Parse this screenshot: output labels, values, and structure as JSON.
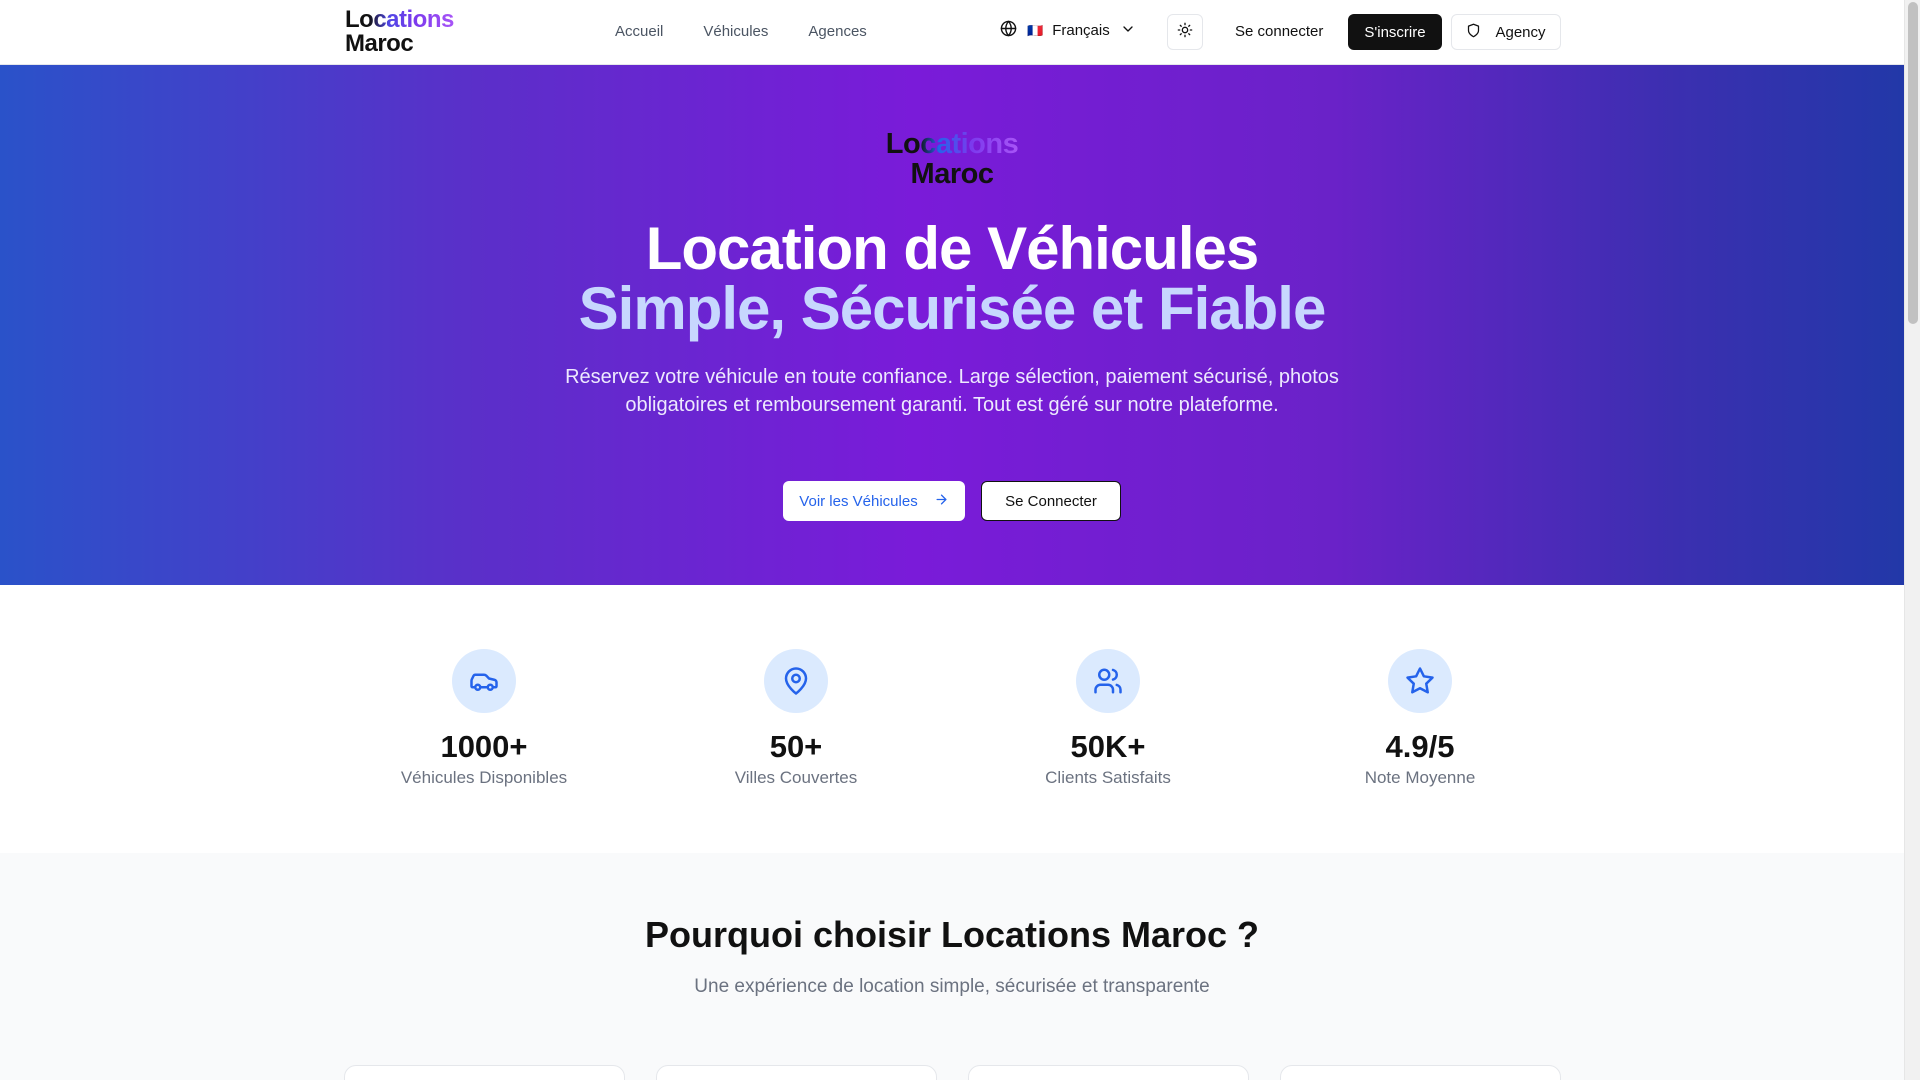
{
  "header": {
    "logo_line1": "Locations",
    "logo_line2": "Maroc",
    "nav": [
      {
        "label": "Accueil"
      },
      {
        "label": "Véhicules"
      },
      {
        "label": "Agences"
      }
    ],
    "language": {
      "flag": "🇫🇷",
      "label": "Français"
    },
    "login_label": "Se connecter",
    "signup_label": "S'inscrire",
    "agency_label": "Agency"
  },
  "hero": {
    "logo_line1": "Locations",
    "logo_line2": "Maroc",
    "title": "Location de Véhicules",
    "subtitle": "Simple, Sécurisée et Fiable",
    "description": "Réservez votre véhicule en toute confiance. Large sélection, paiement sécurisé, photos obligatoires et remboursement garanti. Tout est géré sur notre plateforme.",
    "primary_cta": "Voir les Véhicules",
    "secondary_cta": "Se Connecter"
  },
  "stats": [
    {
      "icon": "car-icon",
      "value": "1000+",
      "label": "Véhicules Disponibles"
    },
    {
      "icon": "map-pin-icon",
      "value": "50+",
      "label": "Villes Couvertes"
    },
    {
      "icon": "users-icon",
      "value": "50K+",
      "label": "Clients Satisfaits"
    },
    {
      "icon": "star-icon",
      "value": "4.9/5",
      "label": "Note Moyenne"
    }
  ],
  "why": {
    "title": "Pourquoi choisir Locations Maroc ?",
    "subtitle": "Une expérience de location simple, sécurisée et transparente"
  },
  "colors": {
    "accent": "#2563eb",
    "hero_gradient_start": "#2a52c9",
    "hero_gradient_mid": "#7a1bd9",
    "hero_gradient_end": "#2238a8",
    "signup_bg": "#111111",
    "stat_icon_bg": "#dbeafe"
  }
}
